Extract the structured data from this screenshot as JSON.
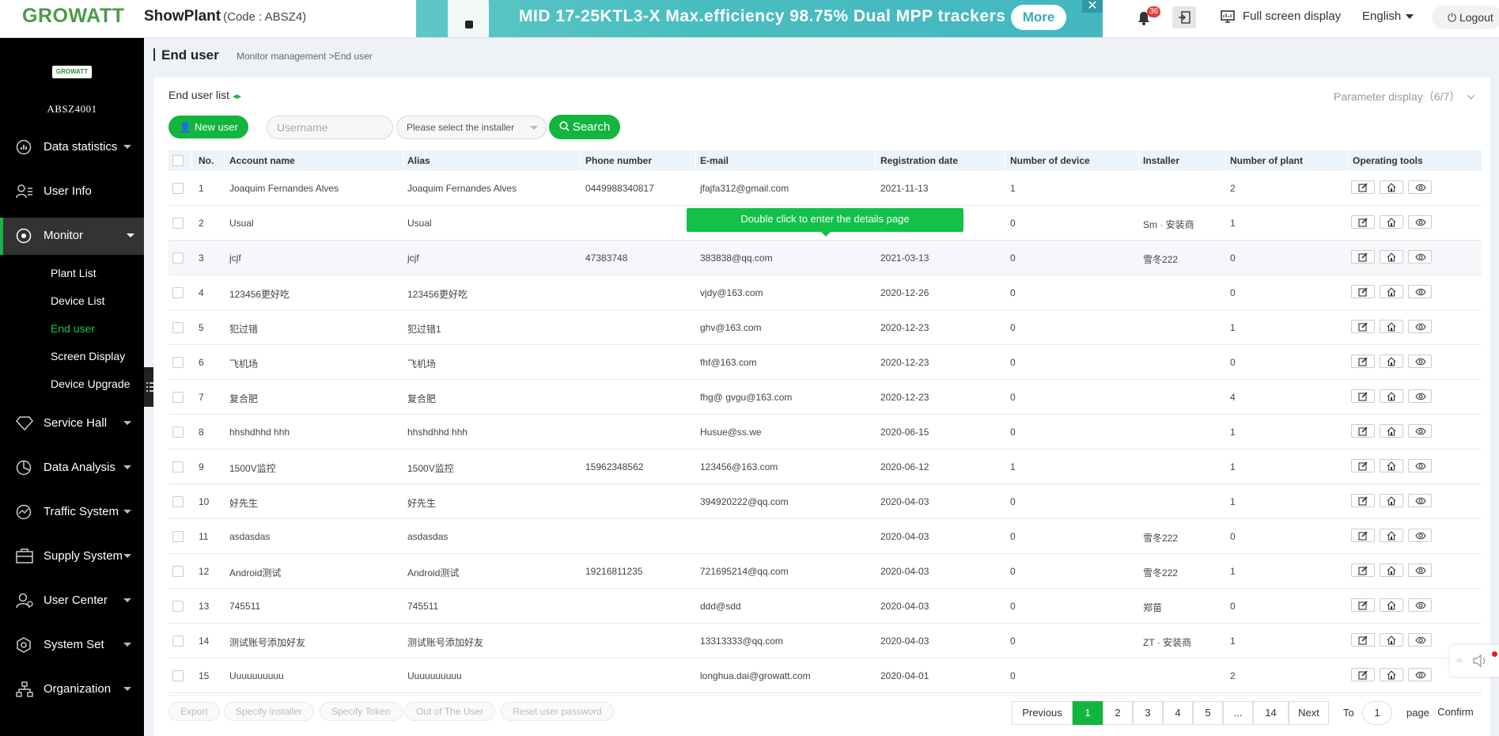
{
  "header": {
    "logo": "GROWATT",
    "app_name": "ShowPlant",
    "code": "(Code : ABSZ4)",
    "banner_text": "MID 17-25KTL3-X  Max.efficiency 98.75%  Dual MPP trackers",
    "banner_more": "More",
    "banner_close": "✕",
    "notifications": "36",
    "fullscreen": "Full screen display",
    "language": "English",
    "logout": "Logout"
  },
  "sidebar": {
    "logo": "GROWATT",
    "username": "ABSZ4001",
    "items": [
      {
        "label": "Data statistics",
        "icon": "bar-chart-icon"
      },
      {
        "label": "User Info",
        "icon": "user-list-icon"
      },
      {
        "label": "Monitor",
        "icon": "monitor-icon"
      },
      {
        "label": "Service Hall",
        "icon": "diamond-icon"
      },
      {
        "label": "Data Analysis",
        "icon": "pie-chart-icon"
      },
      {
        "label": "Traffic System",
        "icon": "traffic-icon"
      },
      {
        "label": "Supply System",
        "icon": "supply-icon"
      },
      {
        "label": "User Center",
        "icon": "user-center-icon"
      },
      {
        "label": "System Set",
        "icon": "settings-hex-icon"
      },
      {
        "label": "Organization",
        "icon": "org-icon"
      }
    ],
    "submenu": [
      "Plant List",
      "Device List",
      "End user",
      "Screen Display",
      "Device Upgrade"
    ]
  },
  "page": {
    "title": "End user",
    "breadcrumb": "Monitor management >End user",
    "list_title": "End user list",
    "param_display": "Parameter display（6/7）"
  },
  "toolbar": {
    "new_user": "New user",
    "username_placeholder": "Username",
    "installer_select": "Please select the installer",
    "search": "Search"
  },
  "tooltip": "Double click to enter the details page",
  "table": {
    "headers": [
      "No.",
      "Account name",
      "Alias",
      "Phone number",
      "E-mail",
      "Registration date",
      "Number of device",
      "Installer",
      "Number of plant",
      "Operating tools"
    ],
    "rows": [
      {
        "no": "1",
        "account": "Joaquim Fernandes Alves",
        "alias": "Joaquim Fernandes Alves",
        "phone": "0449988340817",
        "email": "jfajfa312@gmail.com",
        "date": "2021-11-13",
        "devices": "1",
        "installer": "",
        "plants": "2"
      },
      {
        "no": "2",
        "account": "Usual",
        "alias": "Usual",
        "phone": "",
        "email": "",
        "date": "",
        "devices": "0",
        "installer": "Sm · 安装商",
        "plants": "1"
      },
      {
        "no": "3",
        "account": "jcjf",
        "alias": "jcjf",
        "phone": "47383748",
        "email": "383838@qq.com",
        "date": "2021-03-13",
        "devices": "0",
        "installer": "雪冬222",
        "plants": "0"
      },
      {
        "no": "4",
        "account": "123456更好吃",
        "alias": "123456更好吃",
        "phone": "",
        "email": "vjdy@163.com",
        "date": "2020-12-26",
        "devices": "0",
        "installer": "",
        "plants": "0"
      },
      {
        "no": "5",
        "account": "犯过错",
        "alias": "犯过错1",
        "phone": "",
        "email": "ghv@163.com",
        "date": "2020-12-23",
        "devices": "0",
        "installer": "",
        "plants": "1"
      },
      {
        "no": "6",
        "account": "飞机场",
        "alias": "飞机场",
        "phone": "",
        "email": "fhf@163.com",
        "date": "2020-12-23",
        "devices": "0",
        "installer": "",
        "plants": "0"
      },
      {
        "no": "7",
        "account": "复合肥",
        "alias": "复合肥",
        "phone": "",
        "email": "fhg@ gvgu@163.com",
        "date": "2020-12-23",
        "devices": "0",
        "installer": "",
        "plants": "4"
      },
      {
        "no": "8",
        "account": "hhshdhhd hhh",
        "alias": "hhshdhhd hhh",
        "phone": "",
        "email": "Husue@ss.we",
        "date": "2020-06-15",
        "devices": "0",
        "installer": "",
        "plants": "1"
      },
      {
        "no": "9",
        "account": "1500V监控",
        "alias": "1500V监控",
        "phone": "15962348562",
        "email": "123456@163.com",
        "date": "2020-06-12",
        "devices": "1",
        "installer": "",
        "plants": "1"
      },
      {
        "no": "10",
        "account": "好先生",
        "alias": "好先生",
        "phone": "",
        "email": "394920222@qq.com",
        "date": "2020-04-03",
        "devices": "0",
        "installer": "",
        "plants": "1"
      },
      {
        "no": "11",
        "account": "asdasdas",
        "alias": "asdasdas",
        "phone": "",
        "email": "",
        "date": "2020-04-03",
        "devices": "0",
        "installer": "雪冬222",
        "plants": "0"
      },
      {
        "no": "12",
        "account": "Android测试",
        "alias": "Android测试",
        "phone": "19216811235",
        "email": "721695214@qq.com",
        "date": "2020-04-03",
        "devices": "0",
        "installer": "雪冬222",
        "plants": "1"
      },
      {
        "no": "13",
        "account": "745511",
        "alias": "745511",
        "phone": "",
        "email": "ddd@sdd",
        "date": "2020-04-03",
        "devices": "0",
        "installer": "郑苗",
        "plants": "0"
      },
      {
        "no": "14",
        "account": "测试账号添加好友",
        "alias": "测试账号添加好友",
        "phone": "",
        "email": "13313333@qq.com",
        "date": "2020-04-03",
        "devices": "0",
        "installer": "ZT · 安装商",
        "plants": "1"
      },
      {
        "no": "15",
        "account": "Uuuuuuuuuu",
        "alias": "Uuuuuuuuuu",
        "phone": "",
        "email": "longhua.dai@growatt.com",
        "date": "2020-04-01",
        "devices": "0",
        "installer": "",
        "plants": "2"
      }
    ]
  },
  "footer": {
    "actions": [
      "Export",
      "Specify installer",
      "Specify Token",
      "Out of The User",
      "Reset user password"
    ],
    "previous": "Previous",
    "pages": [
      "1",
      "2",
      "3",
      "4",
      "5",
      "...",
      "14"
    ],
    "next": "Next",
    "to": "To",
    "page_input": "1",
    "page_label": "page",
    "confirm": "Confirm"
  }
}
